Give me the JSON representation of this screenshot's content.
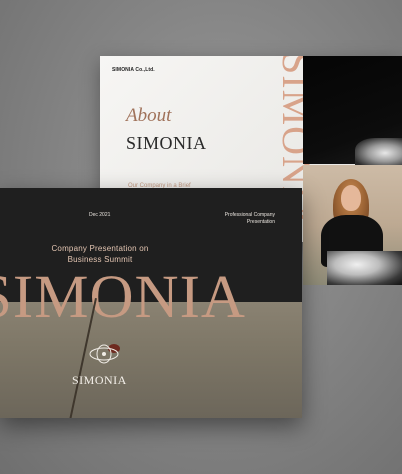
{
  "back_slide": {
    "logo_text": "SIMONIA Co.,Ltd.",
    "heading_italic": "About",
    "heading": "SIMONIA",
    "subheading": "Our Company in a Brief",
    "vertical_brand": "SIMONIA"
  },
  "front_slide": {
    "date": "Dec 2021",
    "right_label_line1": "Professional Company",
    "right_label_line2": "Presentation",
    "presentation_line1": "Company Presentation on",
    "presentation_line2": "Business Summit",
    "big_brand": "SIMONIA",
    "logo_text": "SIMONIA"
  },
  "colors": {
    "accent_rose_gold": "#c69a82",
    "dark_slide": "#1f1f1f",
    "background_gray": "#8a8a8a"
  }
}
